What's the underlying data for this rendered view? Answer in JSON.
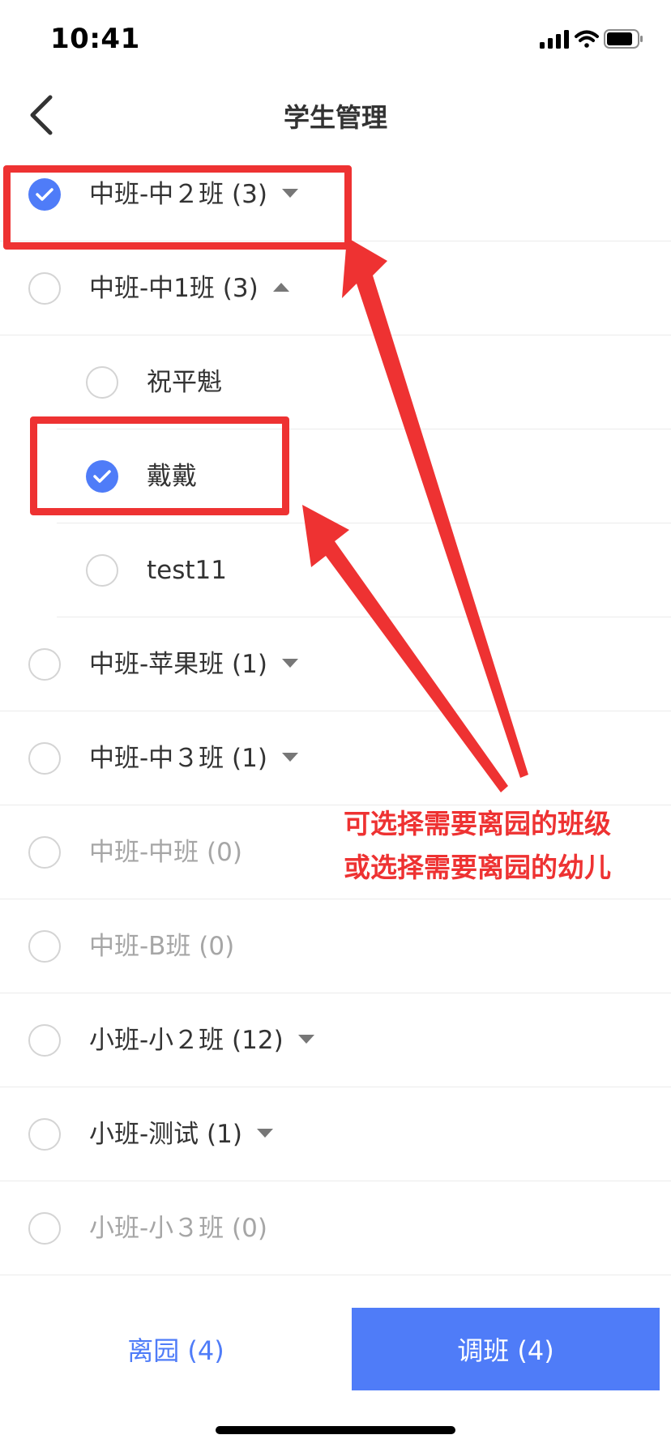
{
  "status_bar": {
    "time": "10:41",
    "icons": [
      "signal-icon",
      "wifi-icon",
      "battery-icon"
    ]
  },
  "nav": {
    "title": "学生管理",
    "back_icon": "chevron-left-icon"
  },
  "list": [
    {
      "label": "中班-中２班 (3)",
      "level": "class",
      "checked": true,
      "expand": "collapsed",
      "muted": false
    },
    {
      "label": "中班-中1班 (3)",
      "level": "class",
      "checked": false,
      "expand": "expanded",
      "muted": false
    },
    {
      "label": "祝平魁",
      "level": "student",
      "checked": false,
      "expand": "none",
      "muted": false
    },
    {
      "label": "戴戴",
      "level": "student",
      "checked": true,
      "expand": "none",
      "muted": false
    },
    {
      "label": "test11",
      "level": "student",
      "checked": false,
      "expand": "none",
      "muted": false
    },
    {
      "label": "中班-苹果班 (1)",
      "level": "class",
      "checked": false,
      "expand": "collapsed",
      "muted": false
    },
    {
      "label": "中班-中３班 (1)",
      "level": "class",
      "checked": false,
      "expand": "collapsed",
      "muted": false
    },
    {
      "label": "中班-中班 (0)",
      "level": "class",
      "checked": false,
      "expand": "none",
      "muted": true
    },
    {
      "label": "中班-B班 (0)",
      "level": "class",
      "checked": false,
      "expand": "none",
      "muted": true
    },
    {
      "label": "小班-小２班 (12)",
      "level": "class",
      "checked": false,
      "expand": "collapsed",
      "muted": false
    },
    {
      "label": "小班-测试 (1)",
      "level": "class",
      "checked": false,
      "expand": "collapsed",
      "muted": false
    },
    {
      "label": "小班-小３班 (0)",
      "level": "class",
      "checked": false,
      "expand": "none",
      "muted": true
    }
  ],
  "annotation": {
    "lines": [
      "可选择需要离园的班级",
      "或选择需要离园的幼儿"
    ]
  },
  "actions": {
    "leave_label": "离园 (4)",
    "transfer_label": "调班 (4)"
  },
  "colors": {
    "accent": "#4f7cf8",
    "annotation": "#ee3232",
    "muted_text": "#a6a6a6"
  }
}
